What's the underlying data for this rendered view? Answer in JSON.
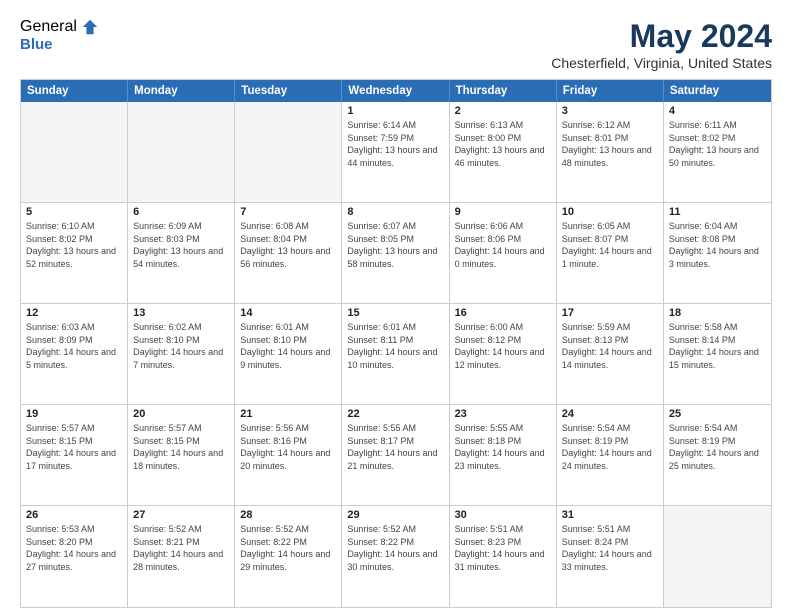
{
  "logo": {
    "general": "General",
    "blue": "Blue"
  },
  "title": "May 2024",
  "subtitle": "Chesterfield, Virginia, United States",
  "days_of_week": [
    "Sunday",
    "Monday",
    "Tuesday",
    "Wednesday",
    "Thursday",
    "Friday",
    "Saturday"
  ],
  "weeks": [
    [
      {
        "day": "",
        "empty": true
      },
      {
        "day": "",
        "empty": true
      },
      {
        "day": "",
        "empty": true
      },
      {
        "day": "1",
        "sunrise": "Sunrise: 6:14 AM",
        "sunset": "Sunset: 7:59 PM",
        "daylight": "Daylight: 13 hours and 44 minutes."
      },
      {
        "day": "2",
        "sunrise": "Sunrise: 6:13 AM",
        "sunset": "Sunset: 8:00 PM",
        "daylight": "Daylight: 13 hours and 46 minutes."
      },
      {
        "day": "3",
        "sunrise": "Sunrise: 6:12 AM",
        "sunset": "Sunset: 8:01 PM",
        "daylight": "Daylight: 13 hours and 48 minutes."
      },
      {
        "day": "4",
        "sunrise": "Sunrise: 6:11 AM",
        "sunset": "Sunset: 8:02 PM",
        "daylight": "Daylight: 13 hours and 50 minutes."
      }
    ],
    [
      {
        "day": "5",
        "sunrise": "Sunrise: 6:10 AM",
        "sunset": "Sunset: 8:02 PM",
        "daylight": "Daylight: 13 hours and 52 minutes."
      },
      {
        "day": "6",
        "sunrise": "Sunrise: 6:09 AM",
        "sunset": "Sunset: 8:03 PM",
        "daylight": "Daylight: 13 hours and 54 minutes."
      },
      {
        "day": "7",
        "sunrise": "Sunrise: 6:08 AM",
        "sunset": "Sunset: 8:04 PM",
        "daylight": "Daylight: 13 hours and 56 minutes."
      },
      {
        "day": "8",
        "sunrise": "Sunrise: 6:07 AM",
        "sunset": "Sunset: 8:05 PM",
        "daylight": "Daylight: 13 hours and 58 minutes."
      },
      {
        "day": "9",
        "sunrise": "Sunrise: 6:06 AM",
        "sunset": "Sunset: 8:06 PM",
        "daylight": "Daylight: 14 hours and 0 minutes."
      },
      {
        "day": "10",
        "sunrise": "Sunrise: 6:05 AM",
        "sunset": "Sunset: 8:07 PM",
        "daylight": "Daylight: 14 hours and 1 minute."
      },
      {
        "day": "11",
        "sunrise": "Sunrise: 6:04 AM",
        "sunset": "Sunset: 8:08 PM",
        "daylight": "Daylight: 14 hours and 3 minutes."
      }
    ],
    [
      {
        "day": "12",
        "sunrise": "Sunrise: 6:03 AM",
        "sunset": "Sunset: 8:09 PM",
        "daylight": "Daylight: 14 hours and 5 minutes."
      },
      {
        "day": "13",
        "sunrise": "Sunrise: 6:02 AM",
        "sunset": "Sunset: 8:10 PM",
        "daylight": "Daylight: 14 hours and 7 minutes."
      },
      {
        "day": "14",
        "sunrise": "Sunrise: 6:01 AM",
        "sunset": "Sunset: 8:10 PM",
        "daylight": "Daylight: 14 hours and 9 minutes."
      },
      {
        "day": "15",
        "sunrise": "Sunrise: 6:01 AM",
        "sunset": "Sunset: 8:11 PM",
        "daylight": "Daylight: 14 hours and 10 minutes."
      },
      {
        "day": "16",
        "sunrise": "Sunrise: 6:00 AM",
        "sunset": "Sunset: 8:12 PM",
        "daylight": "Daylight: 14 hours and 12 minutes."
      },
      {
        "day": "17",
        "sunrise": "Sunrise: 5:59 AM",
        "sunset": "Sunset: 8:13 PM",
        "daylight": "Daylight: 14 hours and 14 minutes."
      },
      {
        "day": "18",
        "sunrise": "Sunrise: 5:58 AM",
        "sunset": "Sunset: 8:14 PM",
        "daylight": "Daylight: 14 hours and 15 minutes."
      }
    ],
    [
      {
        "day": "19",
        "sunrise": "Sunrise: 5:57 AM",
        "sunset": "Sunset: 8:15 PM",
        "daylight": "Daylight: 14 hours and 17 minutes."
      },
      {
        "day": "20",
        "sunrise": "Sunrise: 5:57 AM",
        "sunset": "Sunset: 8:15 PM",
        "daylight": "Daylight: 14 hours and 18 minutes."
      },
      {
        "day": "21",
        "sunrise": "Sunrise: 5:56 AM",
        "sunset": "Sunset: 8:16 PM",
        "daylight": "Daylight: 14 hours and 20 minutes."
      },
      {
        "day": "22",
        "sunrise": "Sunrise: 5:55 AM",
        "sunset": "Sunset: 8:17 PM",
        "daylight": "Daylight: 14 hours and 21 minutes."
      },
      {
        "day": "23",
        "sunrise": "Sunrise: 5:55 AM",
        "sunset": "Sunset: 8:18 PM",
        "daylight": "Daylight: 14 hours and 23 minutes."
      },
      {
        "day": "24",
        "sunrise": "Sunrise: 5:54 AM",
        "sunset": "Sunset: 8:19 PM",
        "daylight": "Daylight: 14 hours and 24 minutes."
      },
      {
        "day": "25",
        "sunrise": "Sunrise: 5:54 AM",
        "sunset": "Sunset: 8:19 PM",
        "daylight": "Daylight: 14 hours and 25 minutes."
      }
    ],
    [
      {
        "day": "26",
        "sunrise": "Sunrise: 5:53 AM",
        "sunset": "Sunset: 8:20 PM",
        "daylight": "Daylight: 14 hours and 27 minutes."
      },
      {
        "day": "27",
        "sunrise": "Sunrise: 5:52 AM",
        "sunset": "Sunset: 8:21 PM",
        "daylight": "Daylight: 14 hours and 28 minutes."
      },
      {
        "day": "28",
        "sunrise": "Sunrise: 5:52 AM",
        "sunset": "Sunset: 8:22 PM",
        "daylight": "Daylight: 14 hours and 29 minutes."
      },
      {
        "day": "29",
        "sunrise": "Sunrise: 5:52 AM",
        "sunset": "Sunset: 8:22 PM",
        "daylight": "Daylight: 14 hours and 30 minutes."
      },
      {
        "day": "30",
        "sunrise": "Sunrise: 5:51 AM",
        "sunset": "Sunset: 8:23 PM",
        "daylight": "Daylight: 14 hours and 31 minutes."
      },
      {
        "day": "31",
        "sunrise": "Sunrise: 5:51 AM",
        "sunset": "Sunset: 8:24 PM",
        "daylight": "Daylight: 14 hours and 33 minutes."
      },
      {
        "day": "",
        "empty": true
      }
    ]
  ]
}
